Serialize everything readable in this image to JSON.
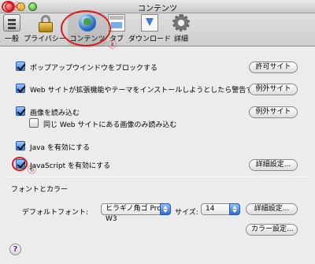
{
  "window": {
    "title": "コンテンツ"
  },
  "toolbar": {
    "items": [
      {
        "label": "一般",
        "icon": "general-icon"
      },
      {
        "label": "プライバシー",
        "icon": "lock-icon"
      },
      {
        "label": "コンテンツ",
        "icon": "globe-icon",
        "selected": true
      },
      {
        "label": "タブ",
        "icon": "tabs-icon"
      },
      {
        "label": "ダウンロード",
        "icon": "download-icon"
      },
      {
        "label": "詳細",
        "icon": "gear-icon"
      }
    ]
  },
  "annotations": {
    "a": "ⓐ",
    "b": "ⓑ",
    "c": "ⓒ",
    "color": "#e01818"
  },
  "options": {
    "popups": {
      "label": "ポップアップウインドウをブロックする",
      "checked": true,
      "button": "許可サイト"
    },
    "extensions": {
      "label": "Web サイトが拡張機能やテーマをインストールしようとしたら警告する",
      "checked": true,
      "button": "例外サイト"
    },
    "images": {
      "label": "画像を読み込む",
      "checked": true,
      "button": "例外サイト"
    },
    "same_site_images": {
      "label": "同じ Web サイトにある画像のみ読み込む",
      "checked": false
    },
    "java": {
      "label": "Java を有効にする",
      "checked": true
    },
    "javascript": {
      "label": "JavaScript を有効にする",
      "checked": true,
      "button": "詳細設定..."
    }
  },
  "fonts": {
    "section_title": "フォントとカラー",
    "default_font_label": "デフォルトフォント:",
    "default_font_value": "ヒラギノ角ゴ Pro W3",
    "size_label": "サイズ:",
    "size_value": "14",
    "font_settings_button": "詳細設定...",
    "color_settings_button": "カラー設定..."
  },
  "help": {
    "glyph": "?"
  }
}
